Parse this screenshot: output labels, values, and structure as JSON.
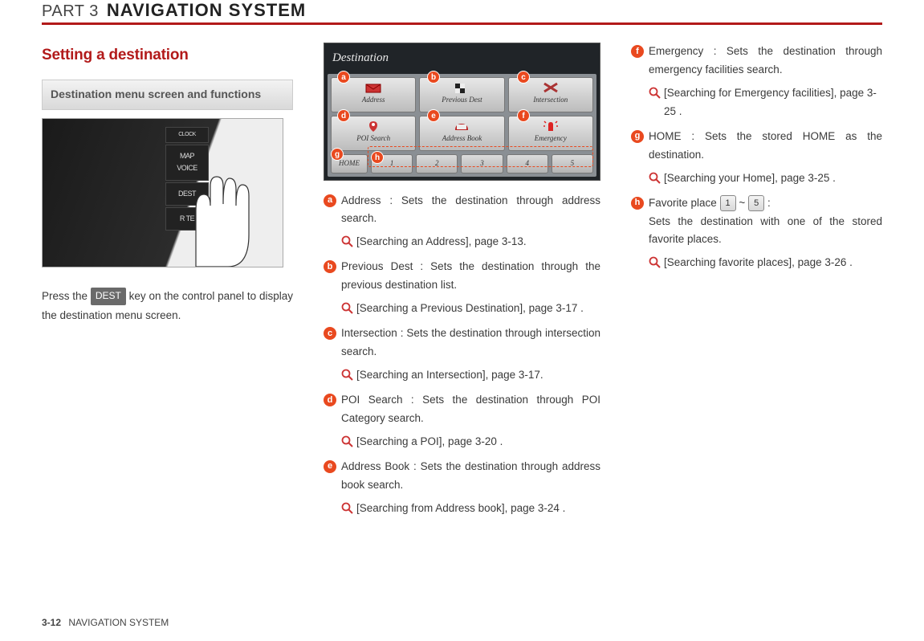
{
  "header": {
    "part": "PART 3",
    "title": "NAVIGATION SYSTEM"
  },
  "section_title": "Setting a destination",
  "subhead": "Destination menu screen and functions",
  "panel_buttons": {
    "clock": "CLOCK",
    "map": "MAP VOICE",
    "dest": "DEST",
    "route": "R        TE"
  },
  "instruction": {
    "pre": "Press the ",
    "key": "DEST",
    "post": " key on the control panel to display the destination menu screen."
  },
  "screenshot": {
    "title": "Destination",
    "row1": [
      {
        "label": "Address"
      },
      {
        "label": "Previous Dest"
      },
      {
        "label": "Intersection"
      }
    ],
    "row2": [
      {
        "label": "POI Search"
      },
      {
        "label": "Address Book"
      },
      {
        "label": "Emergency"
      }
    ],
    "home": "HOME",
    "nums": [
      "1",
      "2",
      "3",
      "4",
      "5"
    ]
  },
  "markers": {
    "a": "a",
    "b": "b",
    "c": "c",
    "d": "d",
    "e": "e",
    "f": "f",
    "g": "g",
    "h": "h"
  },
  "items": {
    "a": {
      "title": "Address : Sets the destination through address search.",
      "ref": "[Searching an Address], page 3-13."
    },
    "b": {
      "title": "Previous Dest : Sets the destination through the previous destination list.",
      "ref": "[Searching a Previous Destination], page 3-17 ."
    },
    "c": {
      "title": "Intersection : Sets the destination through intersection search.",
      "ref": "[Searching an Intersection], page 3-17."
    },
    "d": {
      "title": "POI Search : Sets the destination through POI Category search.",
      "ref": "[Searching a POI], page 3-20 ."
    },
    "e": {
      "title": "Address Book : Sets the destination through address book search.",
      "ref": "[Searching from Address book], page 3-24 ."
    },
    "f": {
      "title": "Emergency : Sets the destination through emergency facilities search.",
      "ref": "[Searching for Emergency facilities], page 3-25 ."
    },
    "g": {
      "title": "HOME : Sets the stored HOME as the destination.",
      "ref": "[Searching your Home], page 3-25 ."
    },
    "h": {
      "pre": "Favorite place ",
      "k1": "1",
      "tilde": " ~ ",
      "k2": "5",
      "post": " :",
      "line2": "Sets the destination with one of the stored favorite places.",
      "ref": "[Searching favorite places], page 3-26 ."
    }
  },
  "footer": {
    "page": "3-12",
    "label": "NAVIGATION SYSTEM"
  }
}
